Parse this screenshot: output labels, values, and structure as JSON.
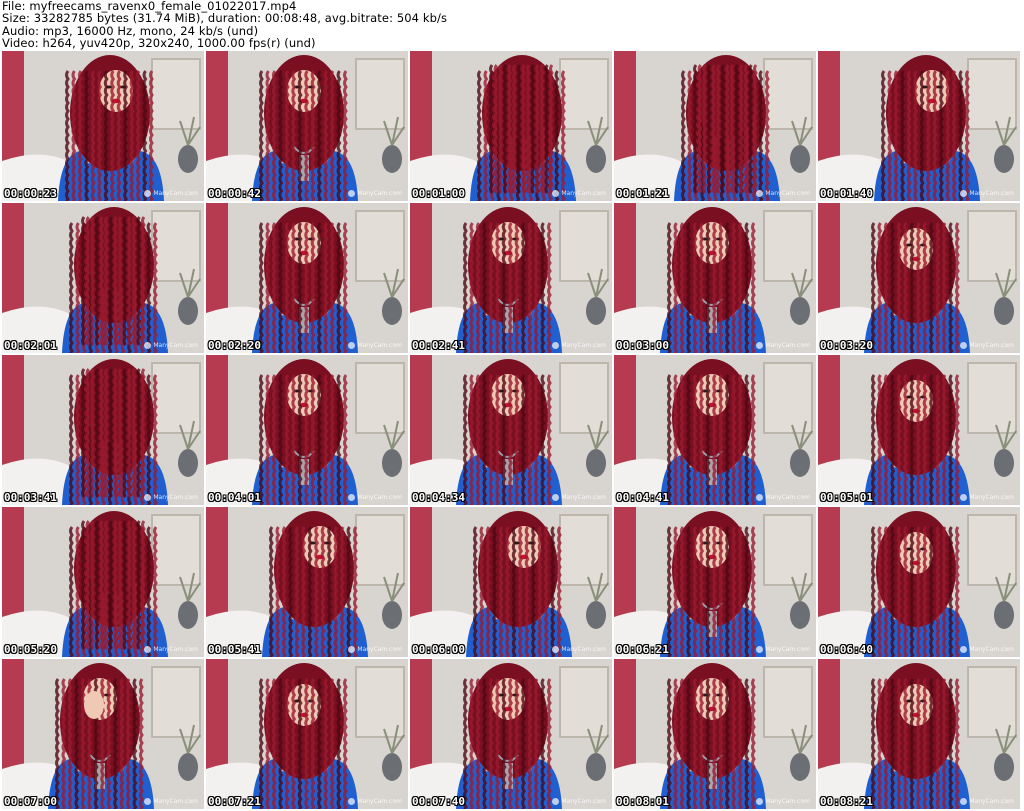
{
  "header": {
    "file": "File: myfreecams_ravenx0_female_01022017.mp4",
    "size": "Size: 33282785 bytes (31.74 MiB), duration: 00:08:48, avg.bitrate: 504 kb/s",
    "audio": "Audio: mp3, 16000 Hz, mono, 24 kb/s (und)",
    "video": "Video: h264, yuv420p, 320x240, 1000.00 fps(r) (und)"
  },
  "watermark": "ManyCam.com",
  "colors": {
    "hair": "#7a0f22",
    "hair_dark": "#4f0714",
    "top": "#1f5fd0",
    "skin": "#f0c9b4",
    "wall": "#d8d4cf",
    "curtain": "#b0203a",
    "frame": "#e2ddd6"
  },
  "thumbnails": [
    {
      "time": "00:00:23",
      "pose": "side"
    },
    {
      "time": "00:00:42",
      "pose": "front"
    },
    {
      "time": "00:01:00",
      "pose": "hidden"
    },
    {
      "time": "00:01:21",
      "pose": "hidden"
    },
    {
      "time": "00:01:40",
      "pose": "side"
    },
    {
      "time": "00:02:01",
      "pose": "hidden"
    },
    {
      "time": "00:02:20",
      "pose": "front"
    },
    {
      "time": "00:02:41",
      "pose": "front"
    },
    {
      "time": "00:03:00",
      "pose": "front"
    },
    {
      "time": "00:03:20",
      "pose": "down"
    },
    {
      "time": "00:03:41",
      "pose": "hidden"
    },
    {
      "time": "00:04:01",
      "pose": "front"
    },
    {
      "time": "00:04:34",
      "pose": "front"
    },
    {
      "time": "00:04:41",
      "pose": "front"
    },
    {
      "time": "00:05:01",
      "pose": "down"
    },
    {
      "time": "00:05:20",
      "pose": "hidden"
    },
    {
      "time": "00:05:41",
      "pose": "side"
    },
    {
      "time": "00:06:00",
      "pose": "side"
    },
    {
      "time": "00:06:21",
      "pose": "front"
    },
    {
      "time": "00:06:40",
      "pose": "down"
    },
    {
      "time": "00:07:00",
      "pose": "hand"
    },
    {
      "time": "00:07:21",
      "pose": "down"
    },
    {
      "time": "00:07:40",
      "pose": "front"
    },
    {
      "time": "00:08:01",
      "pose": "front"
    },
    {
      "time": "00:08:21",
      "pose": "down"
    }
  ]
}
